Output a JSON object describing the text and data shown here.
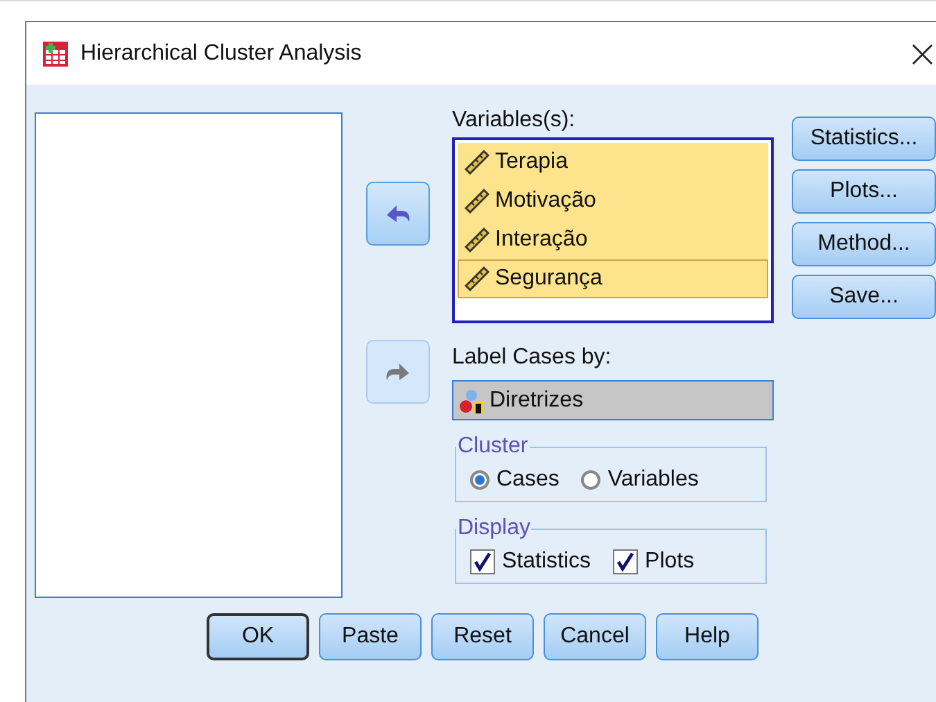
{
  "window": {
    "title": "Hierarchical Cluster Analysis",
    "close": "×"
  },
  "move_buttons": [
    {
      "kind": "back",
      "disabled": false
    },
    {
      "kind": "forward",
      "disabled": true
    }
  ],
  "variables": {
    "label": "Variables(s):",
    "items": [
      {
        "name": "Terapia",
        "selected": true
      },
      {
        "name": "Motivação",
        "selected": true
      },
      {
        "name": "Interação",
        "selected": true
      },
      {
        "name": "Segurança",
        "selected": true
      }
    ]
  },
  "side_buttons": [
    "Statistics...",
    "Plots...",
    "Method...",
    "Save..."
  ],
  "label_cases": {
    "label": "Label Cases by:",
    "value": "Diretrizes"
  },
  "cluster": {
    "title": "Cluster",
    "options": [
      {
        "label": "Cases",
        "selected": true
      },
      {
        "label": "Variables",
        "selected": false
      }
    ]
  },
  "display": {
    "title": "Display",
    "options": [
      {
        "label": "Statistics",
        "checked": true
      },
      {
        "label": "Plots",
        "checked": true
      }
    ]
  },
  "buttons": [
    {
      "label": "OK",
      "default": true
    },
    {
      "label": "Paste",
      "default": false
    },
    {
      "label": "Reset",
      "default": false
    },
    {
      "label": "Cancel",
      "default": false
    },
    {
      "label": "Help",
      "default": false
    }
  ]
}
